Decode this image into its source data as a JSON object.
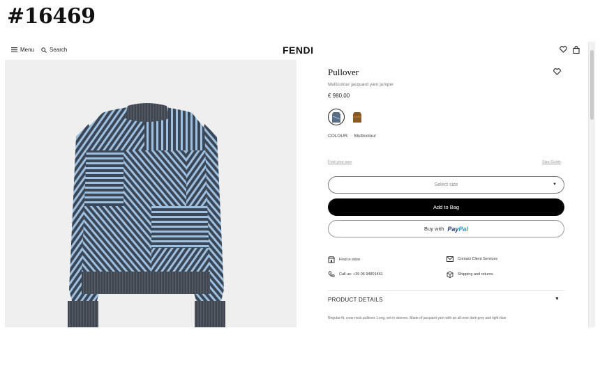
{
  "watermark": "#16469",
  "header": {
    "menu_label": "Menu",
    "search_label": "Search",
    "logo": "FENDI"
  },
  "product": {
    "title": "Pullover",
    "subtitle": "Multicolour jacquard yarn jumper",
    "price": "€ 980,00",
    "colour_label": "COLOUR:",
    "colour_value": "Multicolour",
    "swatch_colors": [
      "#5a6e85",
      "#8a5a22"
    ]
  },
  "size": {
    "find_label": "Find your size",
    "guide_label": "Size Guide",
    "select_placeholder": "Select size"
  },
  "actions": {
    "add_to_bag": "Add to Bag",
    "buy_with": "Buy with",
    "paypal_1": "Pay",
    "paypal_2": "Pal"
  },
  "services": {
    "find_store": "Find in store",
    "contact": "Contact Client Services",
    "call": "Call us: +39 06 94801461",
    "shipping": "Shipping and returns"
  },
  "details": {
    "heading": "PRODUCT DETAILS",
    "description": "Regular-fit, crew-neck pullover. Long, set-in sleeves. Made of jacquard yarn with an all-over dark grey and light blue"
  },
  "colors": {
    "primary": "#000000",
    "paypal_dark": "#253b80",
    "paypal_light": "#179bd7",
    "sweater_base": "#3a4757",
    "sweater_stripe": "#9fc0de"
  }
}
